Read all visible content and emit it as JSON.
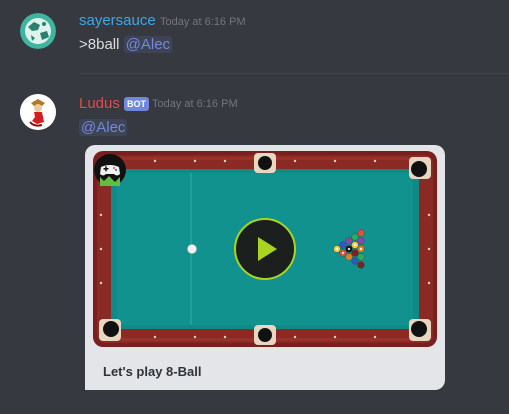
{
  "messages": [
    {
      "username": "sayersauce",
      "username_color": "#3fa7e6",
      "timestamp": "Today at 6:16 PM",
      "text": ">8ball",
      "mention": "@Alec"
    },
    {
      "username": "Ludus",
      "username_color": "#e24b4b",
      "bot_tag": "BOT",
      "timestamp": "Today at 6:16 PM",
      "mention": "@Alec",
      "embed": {
        "caption": "Let's play 8-Ball",
        "image_icon": "pool-table-image",
        "play_icon": "play-icon",
        "badge_icon": "gamepad-icon"
      }
    }
  ],
  "colors": {
    "background": "#36393f",
    "mention": "#7289da",
    "felt": "#0f8a87",
    "rail": "#7a1f1f"
  }
}
